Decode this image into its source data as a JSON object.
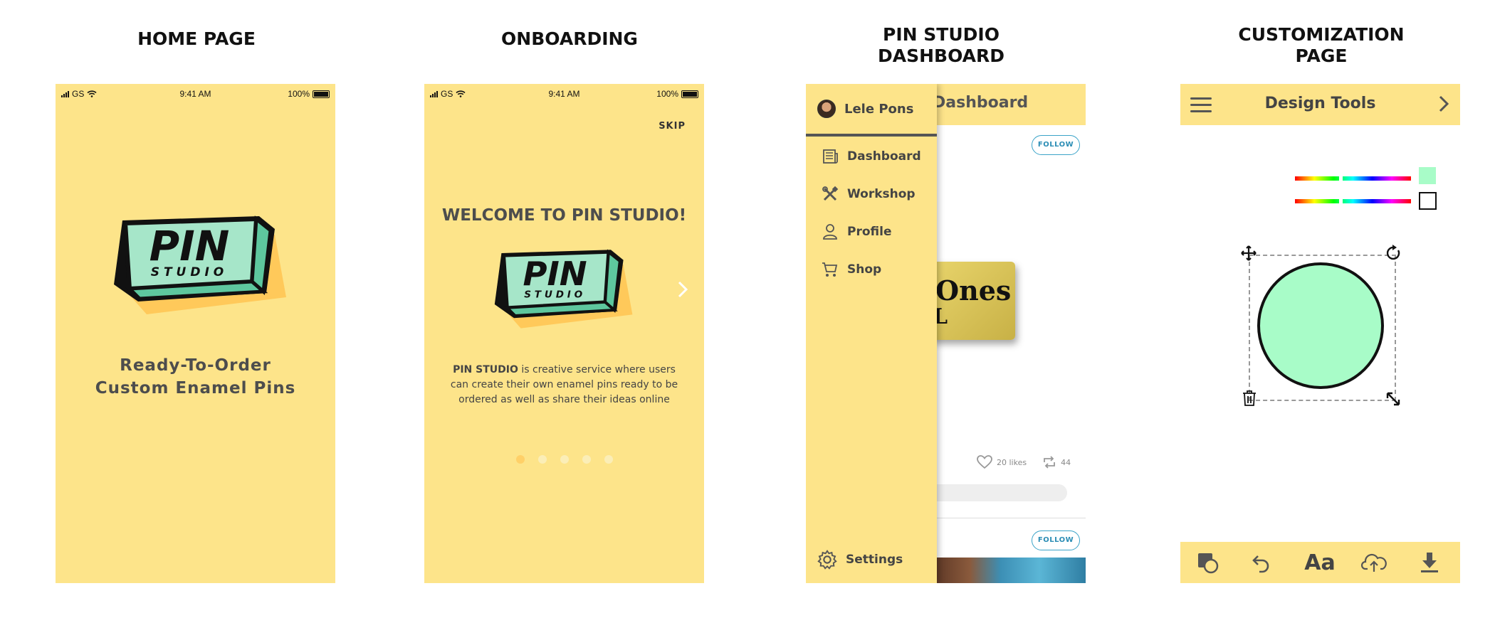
{
  "titles": {
    "home": [
      "HOME PAGE"
    ],
    "onboarding": [
      "ONBOARDING"
    ],
    "dashboard": [
      "PIN STUDIO",
      "DASHBOARD"
    ],
    "customization": [
      "CUSTOMIZATION",
      "PAGE"
    ]
  },
  "status_bar": {
    "carrier": "GS",
    "time": "9:41 AM",
    "battery": "100%"
  },
  "logo": {
    "word1": "PIN",
    "word2": "STUDIO",
    "colors": {
      "face": "#a6e6c9",
      "side": "#5ec79e",
      "shadow": "#ffc95a",
      "outline": "#111111"
    }
  },
  "home": {
    "tagline_line1": "Ready-To-Order",
    "tagline_line2": "Custom Enamel Pins"
  },
  "onboarding": {
    "skip": "SKIP",
    "welcome": "WELCOME TO PIN STUDIO!",
    "next_icon": "chevron-right-icon",
    "description_bold": "PIN STUDIO",
    "description_rest": " is creative service where users can create their own enamel pins ready to be ordered as well as share their ideas online",
    "pages_total": 5,
    "current_page": 1
  },
  "dashboard": {
    "header_title": "Dashboard",
    "user_name": "Lele Pons",
    "nav": [
      {
        "label": "Dashboard",
        "icon": "newspaper-icon"
      },
      {
        "label": "Workshop",
        "icon": "tools-icon"
      },
      {
        "label": "Profile",
        "icon": "person-icon"
      },
      {
        "label": "Shop",
        "icon": "cart-icon"
      }
    ],
    "settings": "Settings",
    "follow": "FOLLOW",
    "pin_text_line1": "Ones",
    "pin_text_line2": "L",
    "likes": "20 likes",
    "reposts": "44"
  },
  "customization": {
    "title": "Design Tools",
    "fill_color": "#a8fcc8",
    "stroke_color": "#111111",
    "font_tool": "Aa",
    "tools": [
      "shapes-icon",
      "undo-icon",
      "text-icon",
      "upload-cloud-icon",
      "download-icon"
    ]
  },
  "colors": {
    "brand_yellow": "#fde48a",
    "text_dark": "#4d4d4d",
    "follow_blue": "#2b8db5"
  }
}
